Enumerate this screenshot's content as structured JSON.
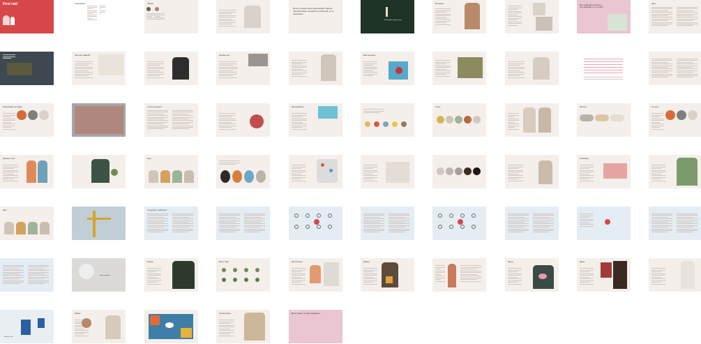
{
  "colors": {
    "cream": "#f4efeb",
    "blue": "#e4ecf4",
    "pink": "#eac5d2",
    "red": "#d64848",
    "dark_green": "#23362a",
    "white": "#ffffff"
  },
  "cover": {
    "title_a": "First",
    "title_sep": "+",
    "title_b": "aid"
  },
  "back_cover": {
    "brand": "First + aid"
  },
  "page_titles": {
    "p2": "Содержание",
    "p3": "Авторы",
    "p7": "Вы знаете",
    "p10": "Цель",
    "p12": "Свет как главный?",
    "p14": "Ошибки при...",
    "p17": "Ваш интерьер",
    "p21": "Когда бывает не видно",
    "p23": "Что за интерьер?",
    "p25": "Как подобрать",
    "p27": "Стиль",
    "p28": "Пастель",
    "p29": "Оттенки",
    "p31": "Как ваш стиль",
    "p33": "Арки",
    "p39": "Сочетание",
    "p41": "Цвет",
    "p42": "Зелень",
    "p43": "Что делать с мебелью?",
    "p51": "Фото и цвет",
    "p53": "Как сочетать",
    "p55": "Мебель",
    "p58": "Цветы",
    "p59": "Декор",
    "p61": "Формы",
    "p62": "О правде",
    "p64": "Уютная мысль",
    "p65": "Мы не знаем, что вам понравится"
  },
  "quotes": {
    "q1": "Не всё должно быть практичным. Иногда обычная вещь становится особенной, и это нормально.",
    "q2": "Мы с вами ещё встретимся, а пока выбирайте то, что радует."
  },
  "photo_captions": {
    "p6": "Выбирайте внимательно",
    "p35": "Цвет и форма",
    "p44": "Бывает и так"
  }
}
